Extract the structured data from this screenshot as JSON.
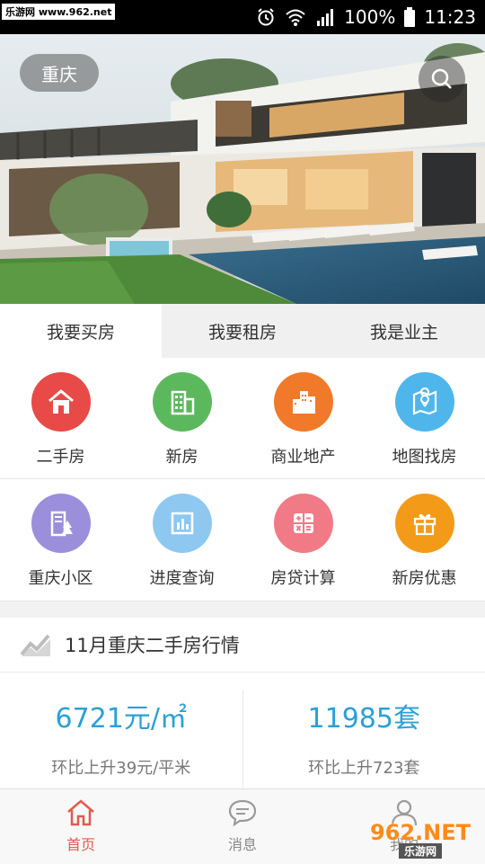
{
  "status_bar": {
    "watermark": "乐游网 www.962.net",
    "battery": "100%",
    "time": "11:23"
  },
  "hero": {
    "city": "重庆"
  },
  "tabs": [
    {
      "label": "我要买房",
      "active": true
    },
    {
      "label": "我要租房",
      "active": false
    },
    {
      "label": "我是业主",
      "active": false
    }
  ],
  "grid": [
    {
      "label": "二手房",
      "icon": "house-icon",
      "color": "#e84a47"
    },
    {
      "label": "新房",
      "icon": "building-icon",
      "color": "#5cb85c"
    },
    {
      "label": "商业地产",
      "icon": "city-icon",
      "color": "#f07a2a"
    },
    {
      "label": "地图找房",
      "icon": "map-pin-icon",
      "color": "#4fb6ec"
    },
    {
      "label": "重庆小区",
      "icon": "community-icon",
      "color": "#9b8fdc"
    },
    {
      "label": "进度查询",
      "icon": "bar-chart-icon",
      "color": "#8ec8f0"
    },
    {
      "label": "房贷计算",
      "icon": "calculator-icon",
      "color": "#f07a86"
    },
    {
      "label": "新房优惠",
      "icon": "gift-icon",
      "color": "#f39b18"
    }
  ],
  "market": {
    "title": "11月重庆二手房行情",
    "price_value": "6721元/㎡",
    "price_change": "环比上升39元/平米",
    "volume_value": "11985套",
    "volume_change": "环比上升723套"
  },
  "bottom_nav": [
    {
      "label": "首页",
      "icon": "home-icon",
      "active": true
    },
    {
      "label": "消息",
      "icon": "message-icon",
      "active": false
    },
    {
      "label": "我的",
      "icon": "user-icon",
      "active": false
    }
  ],
  "corner_watermark": {
    "top": "962.NET",
    "bottom": "乐游网"
  },
  "colors": {
    "accent_blue": "#2aa0d8",
    "active_red": "#e05a4f"
  }
}
